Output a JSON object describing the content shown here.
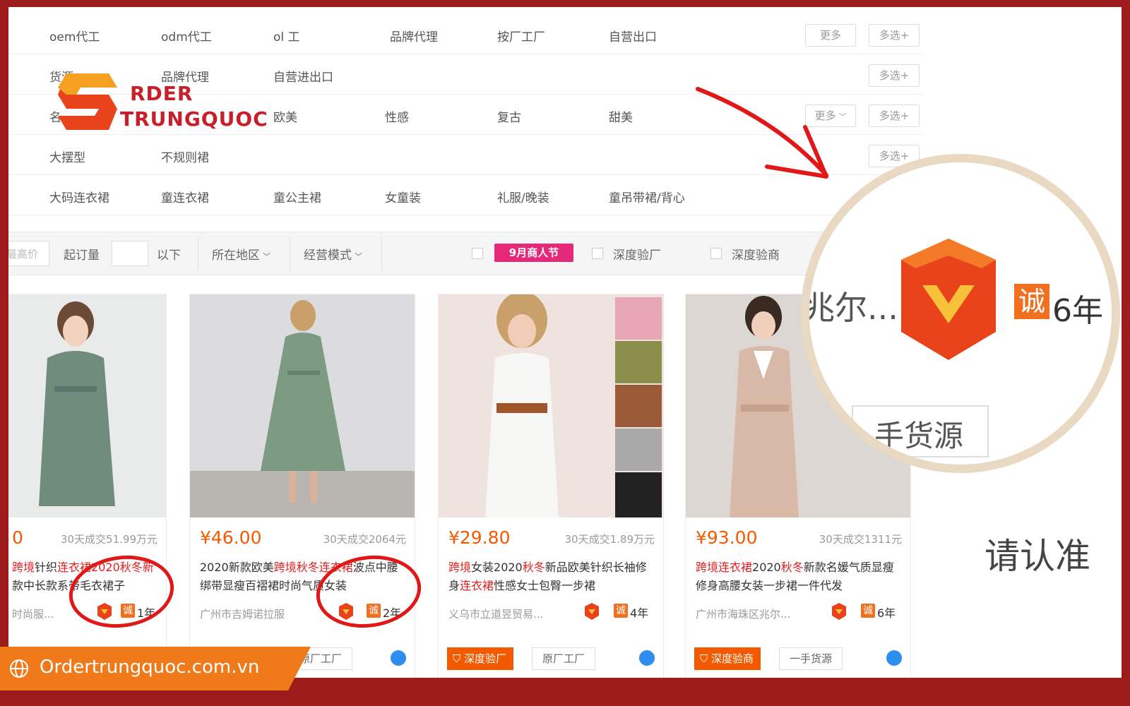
{
  "filters": {
    "rows": [
      {
        "options": [
          "oem代工",
          "odm代工",
          "ol  工",
          "品牌代理",
          "按厂工厂",
          "自营出口"
        ],
        "more_label": "更多",
        "multi_label": "多选+"
      },
      {
        "options": [
          "货源",
          "品牌代理",
          "自营进出口"
        ],
        "more_label": "",
        "multi_label": "多选+"
      },
      {
        "options": [
          "名",
          "",
          "欧美",
          "性感",
          "复古",
          "甜美"
        ],
        "more_label": "更多",
        "multi_label": "多选+"
      },
      {
        "options": [
          "大摆型",
          "不规则裙"
        ],
        "more_label": "",
        "multi_label": "多选+"
      },
      {
        "options": [
          "大码连衣裙",
          "童连衣裙",
          "童公主裙",
          "女童装",
          "礼服/晚装",
          "童吊带裙/背心"
        ],
        "more_label": "",
        "multi_label": ""
      }
    ]
  },
  "sortbar": {
    "max_price_placeholder": "最高价",
    "moq_label": "起订量",
    "moq_suffix": "以下",
    "region_label": "所在地区",
    "mode_label": "经营模式",
    "promo_label": "9月商人节",
    "deep_factory_label": "深度验厂",
    "deep_merchant_label": "深度验商"
  },
  "products": [
    {
      "price": "0",
      "sold": "30天成交51.99万元",
      "title_parts": [
        "跨境",
        "针织",
        "连衣裙",
        "2020秋冬新",
        "款中长款系带毛衣裙子"
      ],
      "shop": "时尚服...",
      "years": "1年",
      "tag1": "",
      "tag2": ""
    },
    {
      "price": "¥46.00",
      "sold": "30天成交2064元",
      "title_parts": [
        "2020新款欧美",
        "跨境秋冬连衣裙",
        "波点中",
        "腰绑带显瘦百褶裙时尚气质女装",
        ""
      ],
      "shop": "广州市吉姆诺拉服",
      "years": "2年",
      "tag1": "",
      "tag2": "原厂工厂"
    },
    {
      "price": "¥29.80",
      "sold": "30天成交1.89万元",
      "title_parts": [
        "跨境",
        "女装2020",
        "秋冬",
        "新品欧美针织长袖修身",
        "连衣裙",
        "性感女士包臀一步裙"
      ],
      "shop": "义乌市立道昱贸易...",
      "years": "4年",
      "tag1": "深度验厂",
      "tag2": "原厂工厂"
    },
    {
      "price": "¥93.00",
      "sold": "30天成交1311元",
      "title_parts": [
        "跨境连衣裙",
        "2020",
        "秋冬",
        "新款名媛气质显瘦修身高腰女装一步裙一件代发"
      ],
      "shop": "广州市海珠区兆尔...",
      "years": "6年",
      "tag1": "深度验商",
      "tag2": "一手货源"
    }
  ],
  "badge": {
    "cheng": "诚"
  },
  "magnifier": {
    "shop_fragment": "兆尔...",
    "years": "6年",
    "cheng": "诚",
    "source_fragment": "手货源"
  },
  "callout": "请认准",
  "logo": {
    "line1": "RDER",
    "line2": "TRUNGQUOC"
  },
  "site": {
    "url": "Ordertrungquoc.com.vn"
  },
  "colors": {
    "frame": "#9c1b1b",
    "price": "#f35a00",
    "highlight": "#e02020",
    "promo": "#e6287b",
    "annotation": "#e01818",
    "magnifier_ring": "#ead9c2"
  }
}
